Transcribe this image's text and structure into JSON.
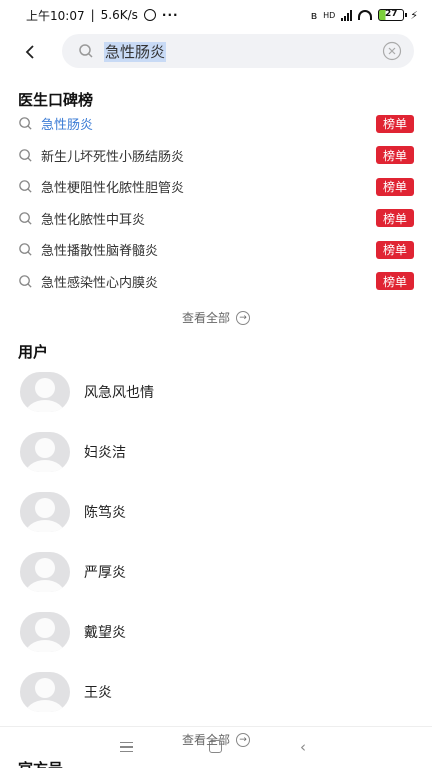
{
  "status_bar": {
    "time": "上午10:07",
    "speed": "5.6K/s",
    "dots": "···",
    "network": "HD",
    "battery": "27",
    "bolt": "⚡"
  },
  "search": {
    "query": "急性肠炎"
  },
  "rank_section": {
    "title": "医生口碑榜",
    "badge": "榜单",
    "items": [
      {
        "text": "急性肠炎"
      },
      {
        "text": "新生儿坏死性小肠结肠炎"
      },
      {
        "text": "急性梗阻性化脓性胆管炎"
      },
      {
        "text": "急性化脓性中耳炎"
      },
      {
        "text": "急性播散性脑脊髓炎"
      },
      {
        "text": "急性感染性心内膜炎"
      }
    ],
    "view_all": "查看全部"
  },
  "user_section": {
    "title": "用户",
    "users": [
      {
        "name": "风急风也情"
      },
      {
        "name": "妇炎洁"
      },
      {
        "name": "陈笃炎"
      },
      {
        "name": "严厚炎"
      },
      {
        "name": "戴望炎"
      },
      {
        "name": "王炎"
      }
    ],
    "view_all": "查看全部"
  },
  "next_section": {
    "title": "官方号"
  },
  "colors": {
    "accent": "#3a7bd5",
    "badge": "#e02433"
  }
}
